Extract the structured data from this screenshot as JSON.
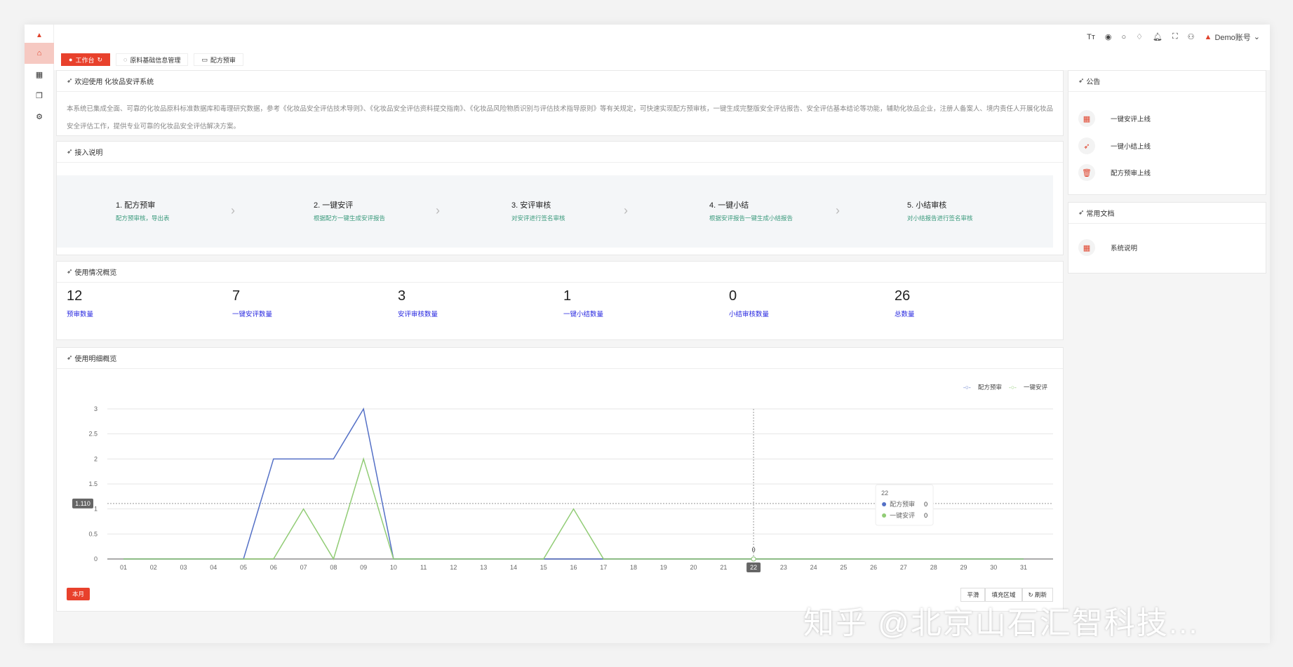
{
  "topbar": {
    "icons": [
      "font-size-icon",
      "record-icon",
      "search-icon",
      "skin-icon",
      "bell-icon",
      "fullscreen-icon",
      "user-icon"
    ],
    "account": "Demo账号"
  },
  "tabs": [
    {
      "label": "工作台",
      "active": true
    },
    {
      "label": "原料基础信息管理"
    },
    {
      "label": "配方预审"
    }
  ],
  "welcome": {
    "title": "欢迎使用 化妆品安评系统",
    "text": "本系统已集成全面、可靠的化妆品原料标准数据库和毒理研究数据，参考《化妆品安全评估技术导则》、《化妆品安全评估资料提交指南》、《化妆品风险物质识别与评估技术指导原则》等有关规定，可快速实现配方预审核，一键生成完整版安全评估报告、安全评估基本结论等功能，辅助化妆品企业，注册人备案人、境内责任人开展化妆品安全评估工作，提供专业可靠的化妆品安全评估解决方案。"
  },
  "access": {
    "title": "接入说明",
    "steps": [
      {
        "title": "1. 配方预审",
        "sub": "配方预审核，导出表"
      },
      {
        "title": "2. 一键安评",
        "sub": "根据配方一键生成安评报告"
      },
      {
        "title": "3. 安评审核",
        "sub": "对安评进行签名审核"
      },
      {
        "title": "4. 一键小结",
        "sub": "根据安评报告一键生成小结报告"
      },
      {
        "title": "5. 小结审核",
        "sub": "对小结报告进行签名审核"
      }
    ]
  },
  "usage": {
    "title": "使用情况概览",
    "stats": [
      {
        "value": "12",
        "label": "预审数量"
      },
      {
        "value": "7",
        "label": "一键安评数量"
      },
      {
        "value": "3",
        "label": "安评审核数量"
      },
      {
        "value": "1",
        "label": "一键小结数量"
      },
      {
        "value": "0",
        "label": "小结审核数量"
      },
      {
        "value": "26",
        "label": "总数量"
      }
    ]
  },
  "detail": {
    "title": "使用明细概览",
    "month_button": "本月",
    "tools": [
      "平滑",
      "填充区域",
      "刷新"
    ]
  },
  "announce": {
    "title": "公告",
    "items": [
      "一键安评上线",
      "一键小结上线",
      "配方预审上线"
    ]
  },
  "docs": {
    "title": "常用文档",
    "items": [
      "系统说明"
    ]
  },
  "watermark": "知乎 @北京山石汇智科技...",
  "chart_data": {
    "type": "line",
    "x": [
      "01",
      "02",
      "03",
      "04",
      "05",
      "06",
      "07",
      "08",
      "09",
      "10",
      "11",
      "12",
      "13",
      "14",
      "15",
      "16",
      "17",
      "18",
      "19",
      "20",
      "21",
      "22",
      "23",
      "24",
      "25",
      "26",
      "27",
      "28",
      "29",
      "30",
      "31"
    ],
    "series": [
      {
        "name": "配方预审",
        "color": "#5470c6",
        "values": [
          0,
          0,
          0,
          0,
          0,
          2,
          2,
          2,
          3,
          0,
          0,
          0,
          0,
          0,
          0,
          0,
          0,
          0,
          0,
          0,
          0,
          0,
          0,
          0,
          0,
          0,
          0,
          0,
          0,
          0,
          0
        ]
      },
      {
        "name": "一键安评",
        "color": "#91cc75",
        "values": [
          0,
          0,
          0,
          0,
          0,
          0,
          1,
          0,
          2,
          0,
          0,
          0,
          0,
          0,
          0,
          1,
          0,
          0,
          0,
          0,
          0,
          0,
          0,
          0,
          0,
          0,
          0,
          0,
          0,
          0,
          0
        ]
      }
    ],
    "ylim": [
      0,
      3
    ],
    "yticks": [
      "0",
      "0.5",
      "1",
      "1.5",
      "2",
      "2.5",
      "3"
    ],
    "legend": "top-right",
    "crosshair": {
      "x": "22",
      "y": "1.110",
      "point_label": "0"
    },
    "tooltip": {
      "title": "22",
      "rows": [
        {
          "name": "配方预审",
          "value": "0"
        },
        {
          "name": "一键安评",
          "value": "0"
        }
      ]
    }
  }
}
